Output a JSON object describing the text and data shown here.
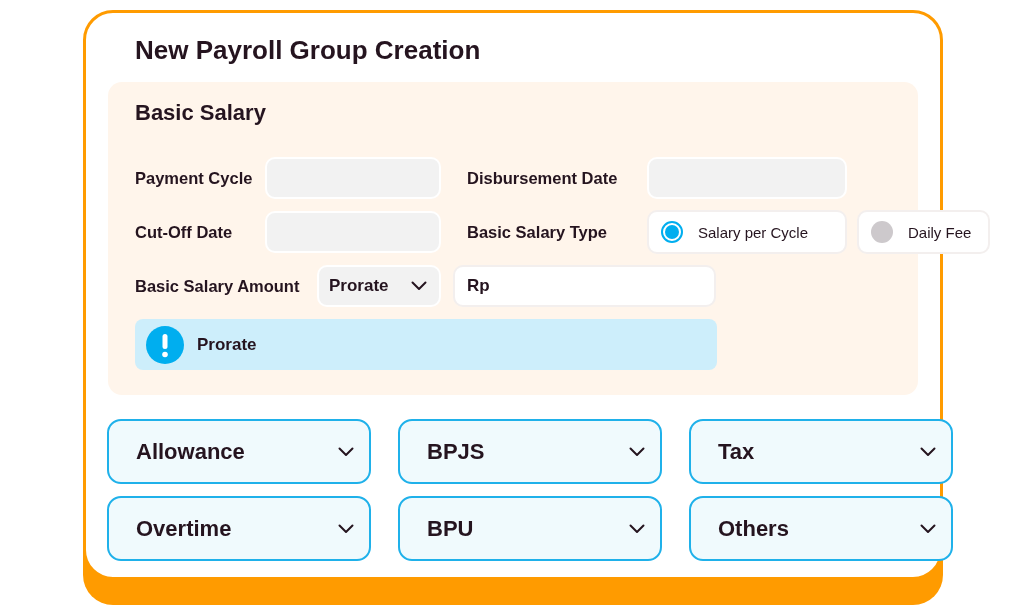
{
  "title": "New Payroll Group Creation",
  "basic_salary": {
    "title": "Basic Salary",
    "payment_cycle": {
      "label": "Payment Cycle"
    },
    "disbursement_date": {
      "label": "Disbursement Date"
    },
    "cut_off_date": {
      "label": "Cut-Off Date"
    },
    "salary_type": {
      "label": "Basic Salary Type",
      "options": [
        {
          "label": "Salary per Cycle",
          "selected": true
        },
        {
          "label": "Daily Fee",
          "selected": false
        }
      ]
    },
    "salary_amount": {
      "label": "Basic Salary Amount",
      "method": {
        "value": "Prorate"
      },
      "amount": {
        "value": "Rp"
      }
    },
    "info": {
      "text": "Prorate"
    }
  },
  "sections": [
    {
      "label": "Allowance",
      "expanded": false
    },
    {
      "label": "BPJS",
      "expanded": false
    },
    {
      "label": "Tax",
      "expanded": false
    },
    {
      "label": "Overtime",
      "expanded": false
    },
    {
      "label": "BPU",
      "expanded": false
    },
    {
      "label": "Others",
      "expanded": false
    }
  ]
}
